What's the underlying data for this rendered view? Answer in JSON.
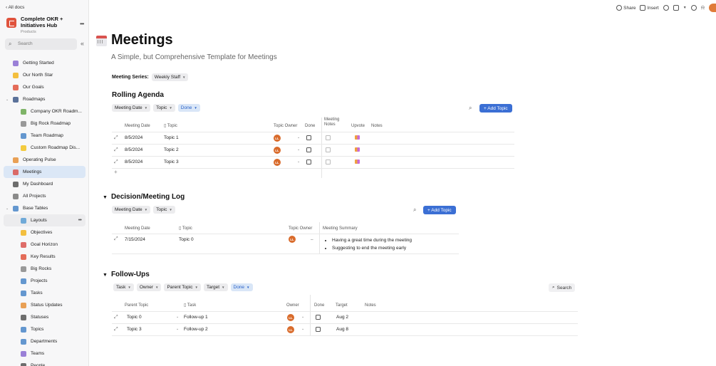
{
  "sidebar": {
    "all_docs": "‹ All docs",
    "doc_title": "Complete OKR + Initiatives Hub",
    "doc_subtitle": "Products",
    "search_placeholder": "Search",
    "items": [
      {
        "label": "Getting Started",
        "icon": "rocket-icon",
        "color": "#8a6bd1"
      },
      {
        "label": "Our North Star",
        "icon": "star-icon",
        "color": "#f2b51f"
      },
      {
        "label": "Our Goals",
        "icon": "target-icon",
        "color": "#e0533d"
      },
      {
        "label": "Roadmaps",
        "icon": "car-icon",
        "color": "#3f5a8a"
      },
      {
        "label": "Company OKR Roadm...",
        "icon": "doc-icon",
        "color": "#6aa84f"
      },
      {
        "label": "Big Rock Roadmap",
        "icon": "rock-icon",
        "color": "#888888"
      },
      {
        "label": "Team Roadmap",
        "icon": "mountain-icon",
        "color": "#4a86c8"
      },
      {
        "label": "Custom Roadmap Dis...",
        "icon": "bulb-icon",
        "color": "#f2c31f"
      },
      {
        "label": "Operating Pulse",
        "icon": "pulse-icon",
        "color": "#e69138"
      },
      {
        "label": "Meetings",
        "icon": "calendar-icon",
        "color": "#d9534f"
      },
      {
        "label": "My Dashboard",
        "icon": "dashboard-icon",
        "color": "#555555"
      },
      {
        "label": "All Projects",
        "icon": "clipboard-icon",
        "color": "#777777"
      },
      {
        "label": "Base Tables",
        "icon": "table-icon",
        "color": "#4a86c8"
      },
      {
        "label": "Layouts",
        "icon": "eye-icon",
        "color": "#5a9fd4"
      },
      {
        "label": "Objectives",
        "icon": "star-icon",
        "color": "#f2b51f"
      },
      {
        "label": "Goal Horizon",
        "icon": "calendar-icon",
        "color": "#d9534f"
      },
      {
        "label": "Key Results",
        "icon": "target-icon",
        "color": "#e0533d"
      },
      {
        "label": "Big Rocks",
        "icon": "rock-icon",
        "color": "#888888"
      },
      {
        "label": "Projects",
        "icon": "chart-icon",
        "color": "#4a86c8"
      },
      {
        "label": "Tasks",
        "icon": "list-icon",
        "color": "#4a86c8"
      },
      {
        "label": "Status Updates",
        "icon": "pulse-icon",
        "color": "#e69138"
      },
      {
        "label": "Statuses",
        "icon": "stack-icon",
        "color": "#555555"
      },
      {
        "label": "Topics",
        "icon": "table-icon",
        "color": "#4a86c8"
      },
      {
        "label": "Departments",
        "icon": "building-icon",
        "color": "#4a86c8"
      },
      {
        "label": "Teams",
        "icon": "people-icon",
        "color": "#8a6bd1"
      },
      {
        "label": "People",
        "icon": "person-icon",
        "color": "#555555"
      }
    ]
  },
  "topbar": {
    "share": "Share",
    "insert": "Insert"
  },
  "page": {
    "title": "Meetings",
    "subtitle": "A Simple, but Comprehensive Template for Meetings",
    "series_label": "Meeting Series:",
    "series_value": "Weekly Staff"
  },
  "rolling": {
    "title": "Rolling Agenda",
    "filters": [
      "Meeting Date",
      "Topic",
      "Done"
    ],
    "add_label": "+ Add Topic",
    "headers": {
      "date": "Meeting Date",
      "topic": "Topic",
      "owner": "Topic Owner",
      "done": "Done",
      "notes_h": "Meeting Notes",
      "upvote": "Upvote",
      "notes": "Notes"
    },
    "rows": [
      {
        "date": "8/5/2024",
        "topic": "Topic 1",
        "owner": "LL"
      },
      {
        "date": "8/5/2024",
        "topic": "Topic 2",
        "owner": "LL"
      },
      {
        "date": "8/5/2024",
        "topic": "Topic 3",
        "owner": "LL"
      }
    ],
    "add_row": "+"
  },
  "decision": {
    "title": "Decision/Meeting Log",
    "filters": [
      "Meeting Date",
      "Topic"
    ],
    "add_label": "+ Add Topic",
    "headers": {
      "date": "Meeting Date",
      "topic": "Topic",
      "owner": "Topic Owner",
      "summary": "Meeting Summary"
    },
    "rows": [
      {
        "date": "7/15/2024",
        "topic": "Topic 0",
        "owner": "LL",
        "dash": "–",
        "summary": [
          "Having a great time during the meeting",
          "Suggesting to end the meeting early"
        ]
      }
    ]
  },
  "followups": {
    "title": "Follow-Ups",
    "filters": [
      "Task",
      "Owner",
      "Parent Topic",
      "Target",
      "Done"
    ],
    "search_label": "Search",
    "headers": {
      "parent": "Parent Topic",
      "task": "Task",
      "owner": "Owner",
      "done": "Done",
      "target": "Target",
      "notes": "Notes"
    },
    "rows": [
      {
        "parent": "Topic 0",
        "task": "Follow-up 1",
        "owner": "LL",
        "target": "Aug 2"
      },
      {
        "parent": "Topic 3",
        "task": "Follow-up 2",
        "owner": "LL",
        "target": "Aug 8"
      }
    ]
  }
}
